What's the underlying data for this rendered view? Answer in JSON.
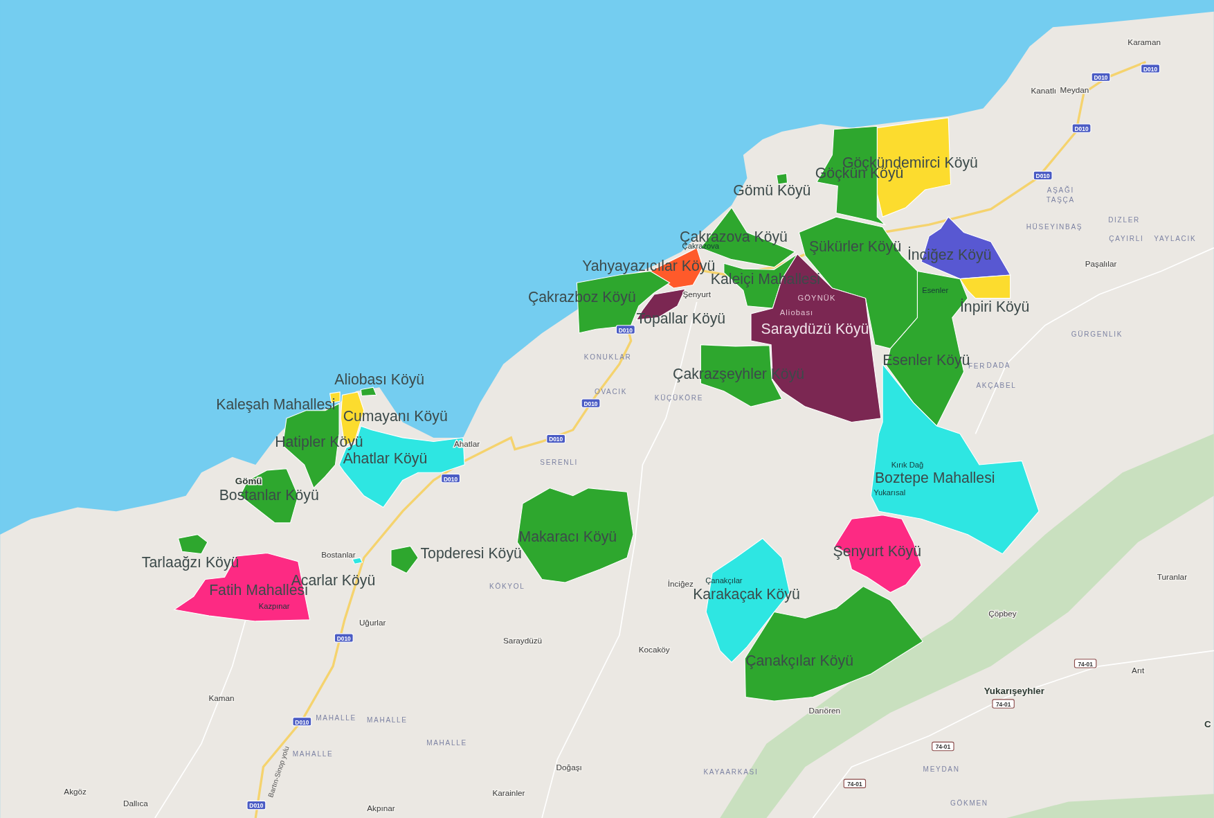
{
  "regions": [
    {
      "name": "Göçkündemirci Köyü",
      "color": "#fcdc2e"
    },
    {
      "name": "Göçkün Köyü",
      "color": "#2ea72e"
    },
    {
      "name": "Gömü Köyü",
      "color": "#2ea72e"
    },
    {
      "name": "Çakrazova Köyü",
      "color": "#2ea72e"
    },
    {
      "name": "Şükürler Köyü",
      "color": "#2ea72e"
    },
    {
      "name": "İnciğez Köyü",
      "color": "#5858d2"
    },
    {
      "name": "İnpiri Köyü",
      "color": "#fcdc2e"
    },
    {
      "name": "Esenler Köyü",
      "color": "#2ea72e"
    },
    {
      "name": "Yahyayazıcılar Köyü",
      "color": "#ff5a2a"
    },
    {
      "name": "Kaleiçi Mahallesi",
      "color": "#2ea72e"
    },
    {
      "name": "Saraydüzü Köyü",
      "color": "#7b2752"
    },
    {
      "name": "Çakrazboz Köyü",
      "color": "#2ea72e"
    },
    {
      "name": "Topallar Köyü",
      "color": "#7b2752"
    },
    {
      "name": "Aliobası Köyü",
      "color": "#2ea72e"
    },
    {
      "name": "Çakrazşeyhler Köyü",
      "color": "#2ea72e"
    },
    {
      "name": "Kaleşah Mahallesi",
      "color": "#fcdc2e"
    },
    {
      "name": "Cumayanı Köyü",
      "color": "#fcdc2e"
    },
    {
      "name": "Hatipler Köyü",
      "color": "#2ea72e"
    },
    {
      "name": "Ahatlar Köyü",
      "color": "#2ee6e2"
    },
    {
      "name": "Bostanlar Köyü",
      "color": "#2ea72e"
    },
    {
      "name": "Tarlaağzı Köyü",
      "color": "#2ea72e"
    },
    {
      "name": "Acarlar Köyü",
      "color": "#2ee6e2"
    },
    {
      "name": "Topderesi Köyü",
      "color": "#2ea72e"
    },
    {
      "name": "Fatih Mahallesi",
      "color": "#fd2a83"
    },
    {
      "name": "Makaracı Köyü",
      "color": "#2ea72e"
    },
    {
      "name": "Boztepe Mahallesi",
      "color": "#2ee6e2"
    },
    {
      "name": "Şenyurt Köyü",
      "color": "#fd2a83"
    },
    {
      "name": "Karakaçak Köyü",
      "color": "#2ee6e2"
    },
    {
      "name": "Çanakçılar Köyü",
      "color": "#2ea72e"
    }
  ],
  "places": [
    {
      "text": "Karaman",
      "kind": "town"
    },
    {
      "text": "Kanatlı",
      "kind": "town"
    },
    {
      "text": "Meydan",
      "kind": "town"
    },
    {
      "text": "AŞAĞI",
      "kind": "district"
    },
    {
      "text": "TAŞÇA",
      "kind": "district"
    },
    {
      "text": "HÜSEYINBAŞ",
      "kind": "district"
    },
    {
      "text": "DIZLER",
      "kind": "district"
    },
    {
      "text": "ÇAYIRLI",
      "kind": "district"
    },
    {
      "text": "YAYLACIK",
      "kind": "district"
    },
    {
      "text": "Paşalılar",
      "kind": "town"
    },
    {
      "text": "GÜRGENLIK",
      "kind": "district"
    },
    {
      "text": "FER",
      "kind": "district"
    },
    {
      "text": "DADA",
      "kind": "district"
    },
    {
      "text": "AKÇABEL",
      "kind": "district"
    },
    {
      "text": "Esenler",
      "kind": "faint"
    },
    {
      "text": "GÖYNÜK",
      "kind": "faint_light"
    },
    {
      "text": "Aliobası",
      "kind": "faint_light"
    },
    {
      "text": "Çakrazova",
      "kind": "faint"
    },
    {
      "text": "Şenyurt",
      "kind": "town"
    },
    {
      "text": "KONUKLAR",
      "kind": "district"
    },
    {
      "text": "OVACIK",
      "kind": "district"
    },
    {
      "text": "KÜÇÜKÖRE",
      "kind": "district"
    },
    {
      "text": "Ahatlar",
      "kind": "town"
    },
    {
      "text": "SERENLI",
      "kind": "district"
    },
    {
      "text": "Gömü",
      "kind": "bold"
    },
    {
      "text": "Bostanlar",
      "kind": "town"
    },
    {
      "text": "Uğurlar",
      "kind": "town"
    },
    {
      "text": "KÖKYOL",
      "kind": "district"
    },
    {
      "text": "Saraydüzü",
      "kind": "town"
    },
    {
      "text": "Kocaköy",
      "kind": "town"
    },
    {
      "text": "İnciğez",
      "kind": "town"
    },
    {
      "text": "Çanakçılar",
      "kind": "faint"
    },
    {
      "text": "Kırık Dağ",
      "kind": "faint"
    },
    {
      "text": "Yukarısal",
      "kind": "faint"
    },
    {
      "text": "Kazpınar",
      "kind": "faint"
    },
    {
      "text": "Turanlar",
      "kind": "town"
    },
    {
      "text": "Çöpbey",
      "kind": "town"
    },
    {
      "text": "Arıt",
      "kind": "town"
    },
    {
      "text": "Yukarışeyhler",
      "kind": "bold"
    },
    {
      "text": "Darıören",
      "kind": "town"
    },
    {
      "text": "Kaman",
      "kind": "town"
    },
    {
      "text": "MAHALLE",
      "kind": "district"
    },
    {
      "text": "MAHALLE",
      "kind": "district"
    },
    {
      "text": "MAHALLE",
      "kind": "district"
    },
    {
      "text": "MAHALLE",
      "kind": "district"
    },
    {
      "text": "Doğaşı",
      "kind": "town"
    },
    {
      "text": "KAYAARKASI",
      "kind": "district"
    },
    {
      "text": "MEYDAN",
      "kind": "district"
    },
    {
      "text": "GÖKMEN",
      "kind": "district"
    },
    {
      "text": "Akgöz",
      "kind": "town"
    },
    {
      "text": "Dallıca",
      "kind": "town"
    },
    {
      "text": "Karainler",
      "kind": "town"
    },
    {
      "text": "Akpınar",
      "kind": "town"
    },
    {
      "text": "C",
      "kind": "bold"
    },
    {
      "text": "Bartın-Sinop yolu",
      "kind": "road_name"
    },
    {
      "text": "D010",
      "kind": "shield"
    },
    {
      "text": "D010",
      "kind": "shield"
    },
    {
      "text": "D010",
      "kind": "shield"
    },
    {
      "text": "D010",
      "kind": "shield"
    },
    {
      "text": "D010",
      "kind": "shield"
    },
    {
      "text": "D010",
      "kind": "shield"
    },
    {
      "text": "D010",
      "kind": "shield"
    },
    {
      "text": "D010",
      "kind": "shield"
    },
    {
      "text": "D010",
      "kind": "shield"
    },
    {
      "text": "D010",
      "kind": "shield"
    },
    {
      "text": "D010",
      "kind": "shield"
    },
    {
      "text": "74-01",
      "kind": "local_shield"
    },
    {
      "text": "74-01",
      "kind": "local_shield"
    },
    {
      "text": "74-01",
      "kind": "local_shield"
    },
    {
      "text": "74-01",
      "kind": "local_shield"
    }
  ]
}
